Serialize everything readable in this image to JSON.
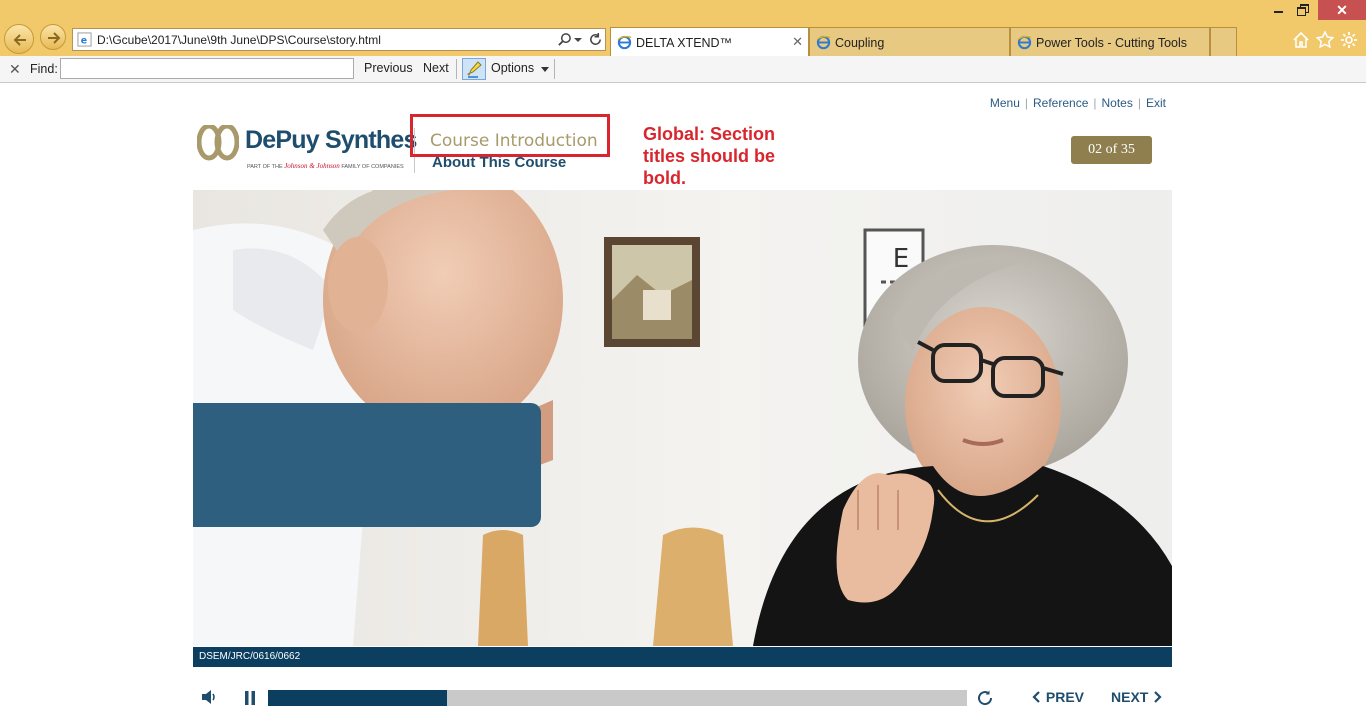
{
  "browser": {
    "address_url": "D:\\Gcube\\2017\\June\\9th June\\DPS\\Course\\story.html",
    "tabs": [
      {
        "label": "DELTA XTEND™",
        "active": true
      },
      {
        "label": "Coupling",
        "active": false
      },
      {
        "label": "Power Tools - Cutting Tools",
        "active": false
      }
    ],
    "icons": [
      "back-icon",
      "forward-icon",
      "ie-icon",
      "search-icon",
      "refresh-icon",
      "home-icon",
      "favorites-star-icon",
      "settings-gear-icon"
    ]
  },
  "findbar": {
    "close_glyph": "✕",
    "label": "Find:",
    "value": "",
    "previous_label": "Previous",
    "next_label": "Next",
    "options_label": "Options"
  },
  "course": {
    "top_links": {
      "menu": "Menu",
      "reference": "Reference",
      "notes": "Notes",
      "exit": "Exit"
    },
    "logo": {
      "brand": "DePuy Synthes",
      "tagline_prefix": "PART OF THE",
      "tagline_company": "Johnson & Johnson",
      "tagline_suffix": "FAMILY OF COMPANIES"
    },
    "section_title": "Course Introduction",
    "subsection_title": "About This Course",
    "annotation": "Global: Section titles should be bold.",
    "page_counter": "02 of 35",
    "footer_code": "DSEM/JRC/0616/0662"
  },
  "player": {
    "progress": 0.256,
    "prev_label": "PREV",
    "next_label": "NEXT"
  },
  "colors": {
    "chrome": "#f1c96a",
    "brand_navy": "#1e4d6d",
    "annotation_red": "#d9262e",
    "badge_gold": "#8f7f4f",
    "footer_navy": "#0c3f5f"
  }
}
